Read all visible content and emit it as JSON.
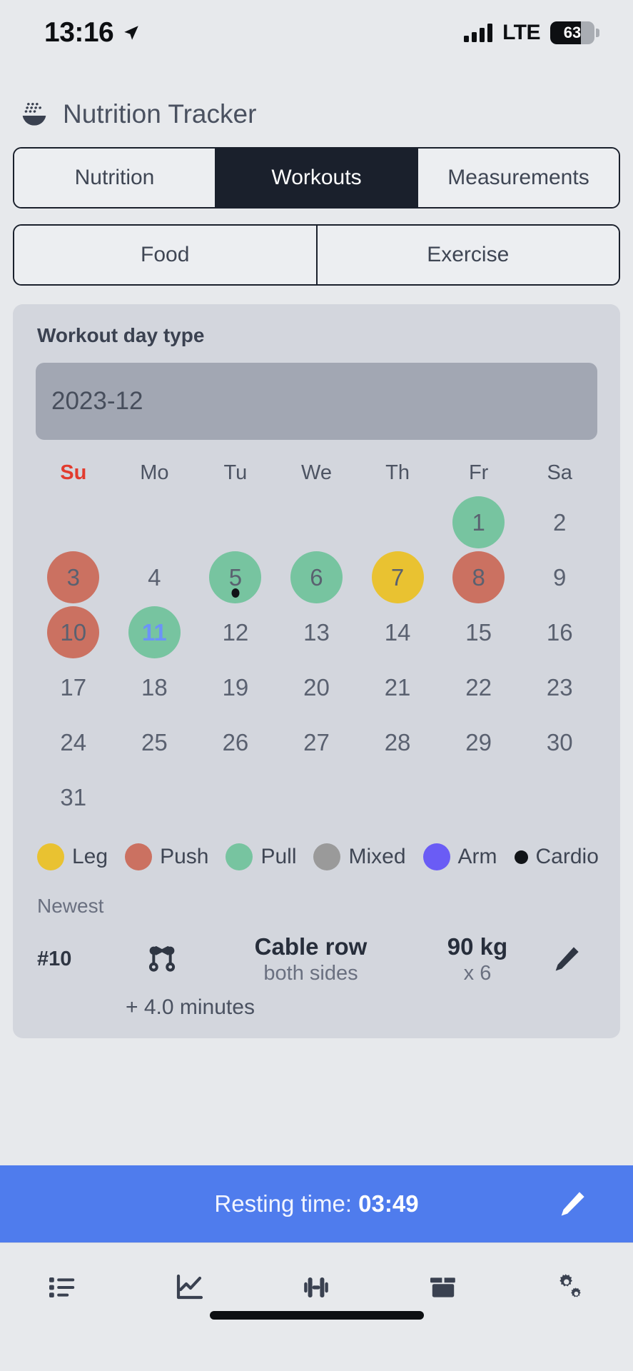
{
  "status_bar": {
    "time": "13:16",
    "location_icon": "location-arrow-icon",
    "signal_icon": "cellular-signal-icon",
    "network": "LTE",
    "battery_percent": "63",
    "battery_icon": "battery-icon"
  },
  "header": {
    "icon": "rice-bowl-icon",
    "title": "Nutrition Tracker"
  },
  "main_tabs": [
    {
      "label": "Nutrition",
      "active": false
    },
    {
      "label": "Workouts",
      "active": true
    },
    {
      "label": "Measurements",
      "active": false
    }
  ],
  "sub_tabs": [
    {
      "label": "Food",
      "active": false
    },
    {
      "label": "Exercise",
      "active": false
    }
  ],
  "card": {
    "title": "Workout day type",
    "month_value": "2023-12"
  },
  "calendar": {
    "weekday_headers": [
      "Su",
      "Mo",
      "Tu",
      "We",
      "Th",
      "Fr",
      "Sa"
    ],
    "weeks": [
      [
        {
          "day": "",
          "type": ""
        },
        {
          "day": "",
          "type": ""
        },
        {
          "day": "",
          "type": ""
        },
        {
          "day": "",
          "type": ""
        },
        {
          "day": "",
          "type": ""
        },
        {
          "day": "1",
          "type": "pull"
        },
        {
          "day": "2",
          "type": ""
        }
      ],
      [
        {
          "day": "3",
          "type": "push"
        },
        {
          "day": "4",
          "type": ""
        },
        {
          "day": "5",
          "type": "pull",
          "cardio": true
        },
        {
          "day": "6",
          "type": "pull"
        },
        {
          "day": "7",
          "type": "leg"
        },
        {
          "day": "8",
          "type": "push"
        },
        {
          "day": "9",
          "type": ""
        }
      ],
      [
        {
          "day": "10",
          "type": "push"
        },
        {
          "day": "11",
          "type": "pull",
          "today": true
        },
        {
          "day": "12",
          "type": ""
        },
        {
          "day": "13",
          "type": ""
        },
        {
          "day": "14",
          "type": ""
        },
        {
          "day": "15",
          "type": ""
        },
        {
          "day": "16",
          "type": ""
        }
      ],
      [
        {
          "day": "17",
          "type": ""
        },
        {
          "day": "18",
          "type": ""
        },
        {
          "day": "19",
          "type": ""
        },
        {
          "day": "20",
          "type": ""
        },
        {
          "day": "21",
          "type": ""
        },
        {
          "day": "22",
          "type": ""
        },
        {
          "day": "23",
          "type": ""
        }
      ],
      [
        {
          "day": "24",
          "type": ""
        },
        {
          "day": "25",
          "type": ""
        },
        {
          "day": "26",
          "type": ""
        },
        {
          "day": "27",
          "type": ""
        },
        {
          "day": "28",
          "type": ""
        },
        {
          "day": "29",
          "type": ""
        },
        {
          "day": "30",
          "type": ""
        }
      ],
      [
        {
          "day": "31",
          "type": ""
        },
        {
          "day": "",
          "type": ""
        },
        {
          "day": "",
          "type": ""
        },
        {
          "day": "",
          "type": ""
        },
        {
          "day": "",
          "type": ""
        },
        {
          "day": "",
          "type": ""
        },
        {
          "day": "",
          "type": ""
        }
      ]
    ]
  },
  "legend": [
    {
      "label": "Leg",
      "color": "#e9c231",
      "small": false
    },
    {
      "label": "Push",
      "color": "#cb7161",
      "small": false
    },
    {
      "label": "Pull",
      "color": "#77c4a0",
      "small": false
    },
    {
      "label": "Mixed",
      "color": "#9a9a9a",
      "small": false
    },
    {
      "label": "Arm",
      "color": "#6a5cf5",
      "small": false
    },
    {
      "label": "Cardio",
      "color": "#111418",
      "small": true
    }
  ],
  "colors": {
    "leg": "#e9c231",
    "push": "#cb7161",
    "pull": "#77c4a0",
    "mixed": "#9a9a9a",
    "arm": "#6a5cf5",
    "cardio": "#111418",
    "accent_blue": "#4f7ced",
    "today_text": "#6c93f7",
    "sunday_red": "#e23b2e",
    "tab_active_bg": "#1a202c",
    "card_bg": "#d3d6dd",
    "page_bg": "#e7e9ec"
  },
  "entry_section": {
    "label": "Newest",
    "index": "#10",
    "exercise_icon": "cable-machine-icon",
    "name": "Cable row",
    "subtitle": "both sides",
    "weight": "90 kg",
    "reps": "x 6",
    "edit_icon": "pencil-icon",
    "extra": "+ 4.0 minutes"
  },
  "resting_bar": {
    "label": "Resting time:",
    "time": "03:49",
    "edit_icon": "pencil-icon"
  },
  "bottom_nav": [
    {
      "icon": "list-icon",
      "name": "nav-list"
    },
    {
      "icon": "chart-line-icon",
      "name": "nav-stats"
    },
    {
      "icon": "dumbbell-icon",
      "name": "nav-workouts"
    },
    {
      "icon": "box-icon",
      "name": "nav-archive"
    },
    {
      "icon": "gears-icon",
      "name": "nav-settings"
    }
  ]
}
